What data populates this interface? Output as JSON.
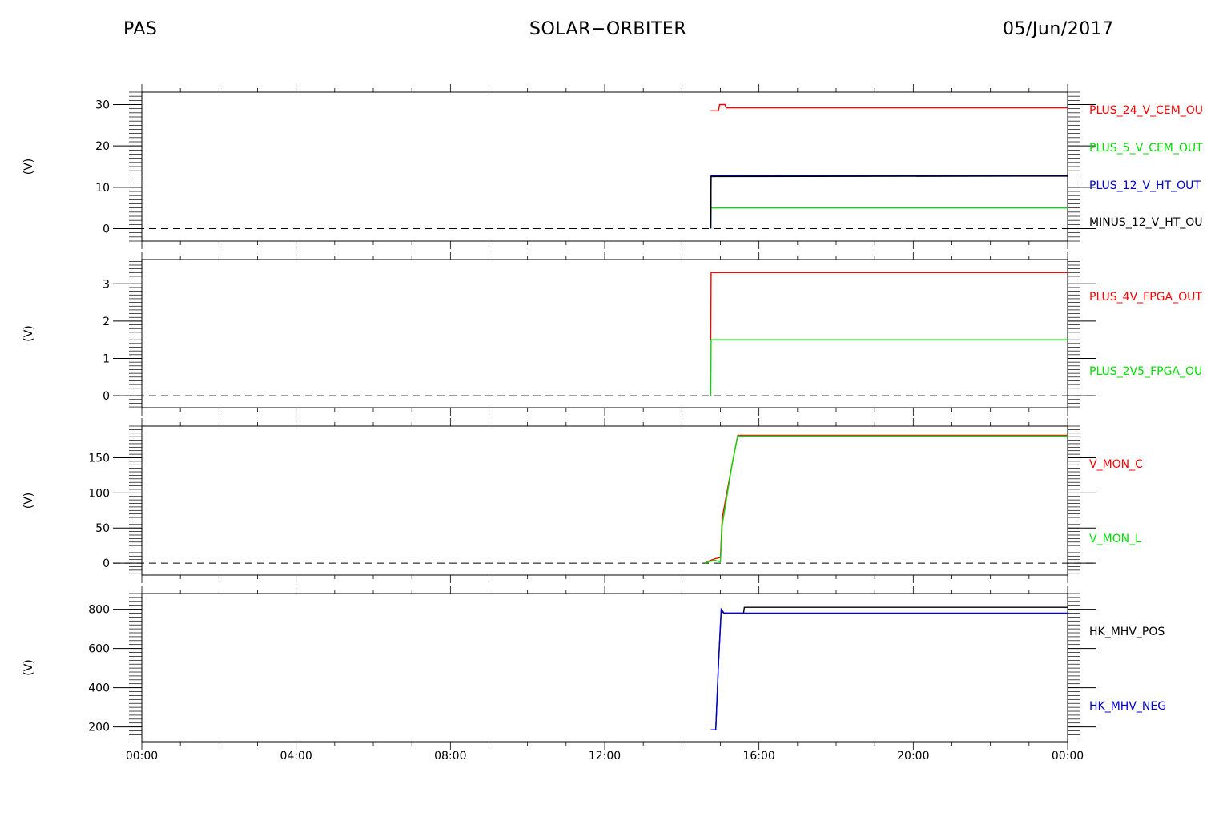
{
  "header": {
    "left": "PAS",
    "center": "SOLAR−ORBITER",
    "right": "05/Jun/2017"
  },
  "x_axis": {
    "tick_labels": [
      "00:00",
      "04:00",
      "08:00",
      "12:00",
      "16:00",
      "20:00",
      "00:00"
    ],
    "range_hours": [
      0,
      24
    ]
  },
  "chart_data": [
    {
      "type": "line",
      "ylabel": "(V)",
      "ylim": [
        -3,
        33
      ],
      "yticks": [
        0,
        10,
        20,
        30
      ],
      "zero_line": "dashed",
      "series": [
        {
          "name": "PLUS_24_V_CEM_OU",
          "color": "#ff0000",
          "points": [
            [
              14.75,
              28.5
            ],
            [
              14.95,
              28.5
            ],
            [
              14.98,
              30
            ],
            [
              15.12,
              30
            ],
            [
              15.15,
              29.2
            ],
            [
              24,
              29.2
            ]
          ]
        },
        {
          "name": "PLUS_5_V_CEM_OUT",
          "color": "#00dd00",
          "points": [
            [
              14.75,
              0
            ],
            [
              14.76,
              5.0
            ],
            [
              24,
              5.0
            ]
          ]
        },
        {
          "name": "PLUS_12_V_HT_OUT",
          "color": "#0000cc",
          "points": [
            [
              14.75,
              0
            ],
            [
              14.76,
              12.8
            ],
            [
              24,
              12.8
            ]
          ]
        },
        {
          "name": "MINUS_12_V_HT_OU",
          "color": "#000000",
          "points": [
            [
              14.75,
              0
            ],
            [
              14.76,
              12.6
            ],
            [
              24,
              12.7
            ]
          ]
        }
      ]
    },
    {
      "type": "line",
      "ylabel": "(V)",
      "ylim": [
        -0.32,
        3.65
      ],
      "yticks": [
        0,
        1,
        2,
        3
      ],
      "zero_line": "dashed",
      "series": [
        {
          "name": "PLUS_4V_FPGA_OUT",
          "color": "#ff0000",
          "points": [
            [
              14.75,
              1.5
            ],
            [
              14.76,
              3.3
            ],
            [
              24,
              3.3
            ]
          ]
        },
        {
          "name": "PLUS_2V5_FPGA_OU",
          "color": "#00dd00",
          "points": [
            [
              14.75,
              0
            ],
            [
              14.76,
              1.5
            ],
            [
              24,
              1.5
            ]
          ]
        }
      ]
    },
    {
      "type": "line",
      "ylabel": "(V)",
      "ylim": [
        -17,
        195
      ],
      "yticks": [
        0,
        50,
        100,
        150
      ],
      "zero_line": "dashed",
      "series": [
        {
          "name": "V_MON_C",
          "color": "#ff0000",
          "points": [
            [
              14.6,
              0
            ],
            [
              14.7,
              3
            ],
            [
              14.85,
              6
            ],
            [
              15.0,
              8
            ],
            [
              15.05,
              65
            ],
            [
              15.3,
              140
            ],
            [
              15.45,
              182
            ],
            [
              24,
              182
            ]
          ]
        },
        {
          "name": "V_MON_L",
          "color": "#00dd00",
          "points": [
            [
              14.6,
              0
            ],
            [
              14.7,
              2
            ],
            [
              14.85,
              4
            ],
            [
              15.0,
              2
            ],
            [
              15.05,
              55
            ],
            [
              15.3,
              140
            ],
            [
              15.45,
              181
            ],
            [
              24,
              181
            ]
          ]
        }
      ]
    },
    {
      "type": "line",
      "ylabel": "(V)",
      "ylim": [
        125,
        880
      ],
      "yticks": [
        200,
        400,
        600,
        800
      ],
      "zero_line": "none",
      "series": [
        {
          "name": "HK_MHV_POS",
          "color": "#000000",
          "points": [
            [
              14.75,
              185
            ],
            [
              14.88,
              185
            ],
            [
              14.95,
              520
            ],
            [
              15.02,
              790
            ],
            [
              15.1,
              780
            ],
            [
              15.6,
              780
            ],
            [
              15.62,
              810
            ],
            [
              24,
              810
            ]
          ]
        },
        {
          "name": "HK_MHV_NEG",
          "color": "#0000cc",
          "points": [
            [
              14.75,
              185
            ],
            [
              14.88,
              185
            ],
            [
              14.95,
              520
            ],
            [
              15.02,
              800
            ],
            [
              15.1,
              780
            ],
            [
              24,
              780
            ]
          ]
        }
      ]
    }
  ]
}
